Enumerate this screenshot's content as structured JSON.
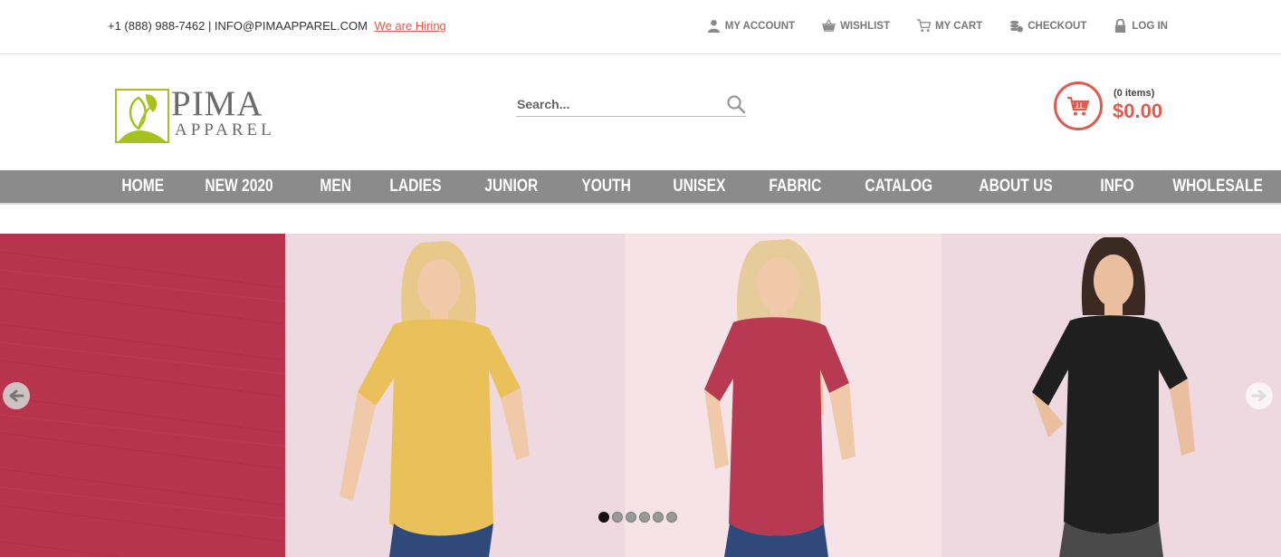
{
  "topbar": {
    "contact_text": "+1 (888) 988-7462 | INFO@PIMAAPPAREL.COM",
    "hiring_link": "We are Hiring",
    "links": [
      {
        "label": "MY ACCOUNT",
        "icon": "user-icon"
      },
      {
        "label": "WISHLIST",
        "icon": "basket-icon"
      },
      {
        "label": "MY CART",
        "icon": "cart-icon"
      },
      {
        "label": "CHECKOUT",
        "icon": "coins-icon"
      },
      {
        "label": "LOG IN",
        "icon": "lock-icon"
      }
    ]
  },
  "header": {
    "logo_word1": "PIMA",
    "logo_word2": "APPAREL",
    "search_placeholder": "Search...",
    "cart_count": "(0 items)",
    "cart_total": "$0.00"
  },
  "nav": {
    "items": [
      "HOME",
      "NEW 2020",
      "MEN",
      "LADIES",
      "JUNIOR",
      "YOUTH",
      "UNISEX",
      "FABRIC",
      "CATALOG",
      "ABOUT US",
      "INFO",
      "WHOLESALE"
    ]
  },
  "slider": {
    "slide_count": 6,
    "active_slide": 1
  },
  "colors": {
    "accent": "#e05a4e",
    "nav_bg": "#8b8b8b",
    "logo_green": "#a5c21e"
  }
}
